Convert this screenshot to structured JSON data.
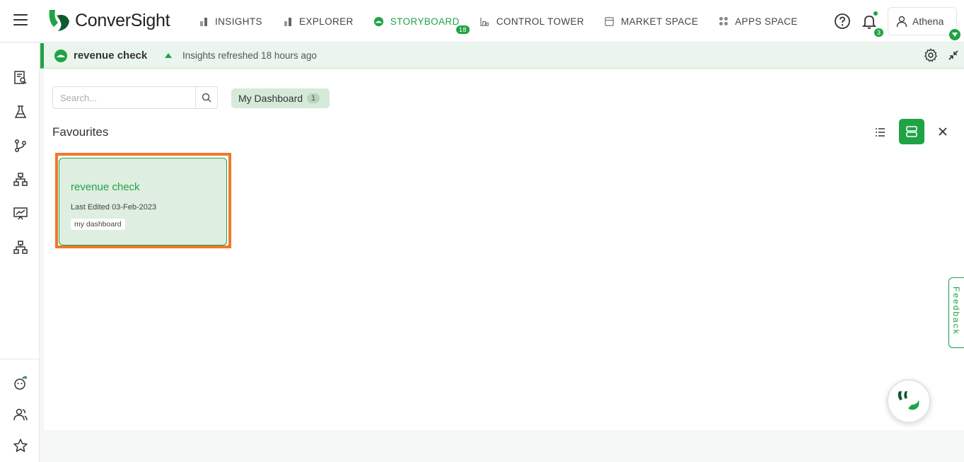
{
  "app": {
    "logo_text": "ConverSight",
    "brand_color": "#1fa344",
    "highlight_color": "#f0782c"
  },
  "nav": {
    "items": [
      {
        "label": "INSIGHTS",
        "icon": "bar-chart-icon",
        "active": false
      },
      {
        "label": "EXPLORER",
        "icon": "bar-chart-icon",
        "active": false
      },
      {
        "label": "STORYBOARD",
        "icon": "storyboard-icon",
        "active": true,
        "badge": "18"
      },
      {
        "label": "CONTROL TOWER",
        "icon": "tower-icon",
        "active": false
      },
      {
        "label": "MARKET SPACE",
        "icon": "market-icon",
        "active": false
      },
      {
        "label": "APPS SPACE",
        "icon": "apps-grid-icon",
        "active": false
      }
    ]
  },
  "header": {
    "notification_count": "3",
    "user_name": "Athena"
  },
  "storyboard": {
    "title": "revenue check",
    "refreshed": "Insights refreshed 18 hours ago"
  },
  "search": {
    "placeholder": "Search..."
  },
  "filter_chip": {
    "label": "My Dashboard",
    "count": "1"
  },
  "favourites": {
    "title": "Favourites",
    "cards": [
      {
        "title": "revenue check",
        "last_edited": "Last Edited 03-Feb-2023",
        "tag": "my dashboard"
      }
    ]
  },
  "feedback_label": "Feedback"
}
